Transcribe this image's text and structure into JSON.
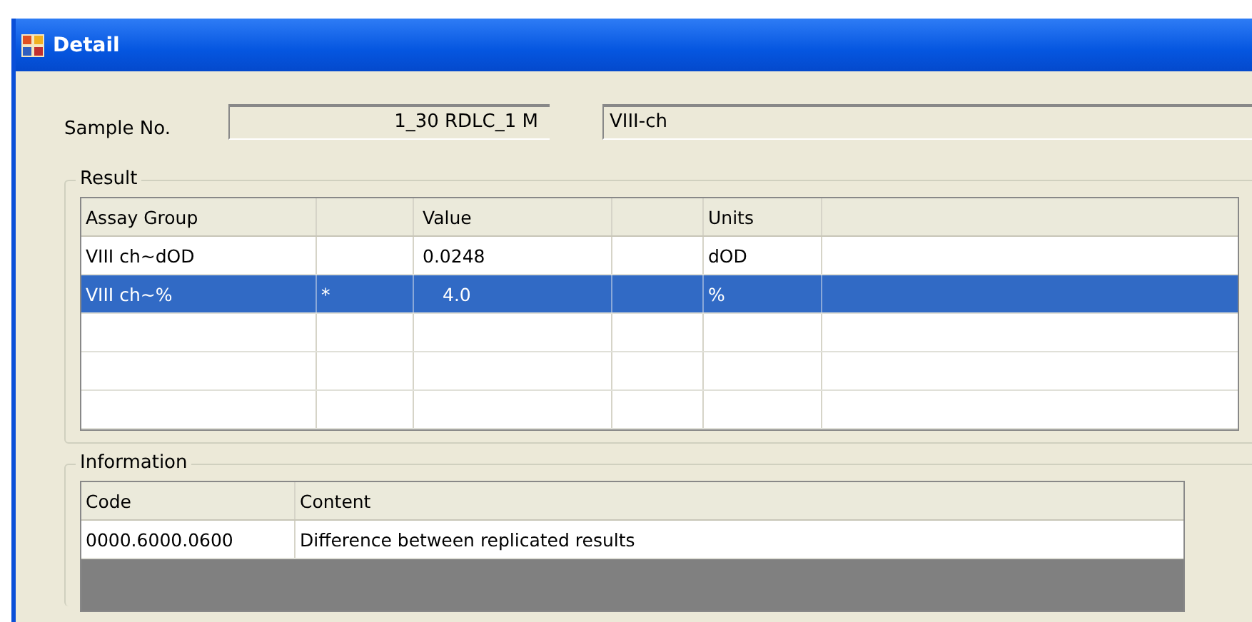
{
  "window": {
    "title": "Detail"
  },
  "sample": {
    "label": "Sample No.",
    "number": "1_30 RDLC_1 M",
    "name": "VIII-ch"
  },
  "result": {
    "title": "Result",
    "columns": [
      "Assay Group",
      "",
      "Value",
      "",
      "Units",
      ""
    ],
    "rows": [
      {
        "cells": [
          "VIII ch~dOD",
          "",
          "0.0248",
          "",
          "dOD",
          ""
        ],
        "selected": false
      },
      {
        "cells": [
          "VIII ch~%",
          "*",
          "4.0",
          "",
          "%",
          ""
        ],
        "selected": true
      }
    ]
  },
  "information": {
    "title": "Information",
    "columns": [
      "Code",
      "Content"
    ],
    "rows": [
      {
        "cells": [
          "0000.6000.0600",
          "Difference between replicated results"
        ],
        "selected": false
      }
    ]
  }
}
